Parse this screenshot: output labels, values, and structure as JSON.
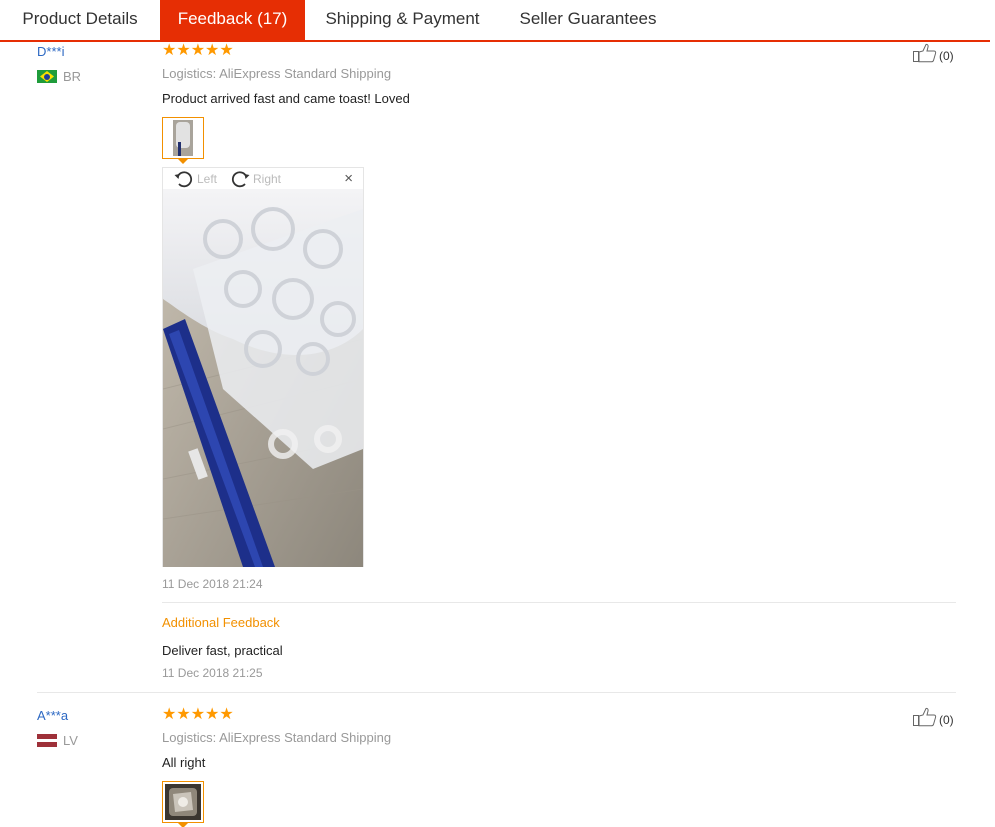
{
  "tabs": [
    {
      "label": "Product Details",
      "active": false
    },
    {
      "label": "Feedback (17)",
      "active": true
    },
    {
      "label": "Shipping & Payment",
      "active": false
    },
    {
      "label": "Seller Guarantees",
      "active": false
    }
  ],
  "reviews": [
    {
      "user": "D***i",
      "country": "BR",
      "stars": "★★★★★",
      "logistics": "Logistics: AliExpress Standard Shipping",
      "comment": "Product arrived fast and came toast! Loved",
      "helpful_count": "(0)",
      "viewer": {
        "left_label": "Left",
        "right_label": "Right",
        "close": "×"
      },
      "date": "11 Dec 2018 21:24",
      "additional_label": "Additional Feedback",
      "additional_comment": "Deliver fast, practical",
      "additional_date": "11 Dec 2018 21:25"
    },
    {
      "user": "A***a",
      "country": "LV",
      "stars": "★★★★★",
      "logistics": "Logistics: AliExpress Standard Shipping",
      "comment": "All right",
      "helpful_count": "(0)"
    }
  ],
  "colors": {
    "accent": "#e62e04",
    "stars": "#ff9900",
    "user_link": "#2c68c3",
    "additional": "#f29000"
  },
  "icons": [
    "thumbs-up-icon",
    "rotate-left-icon",
    "rotate-right-icon",
    "close-icon",
    "flag-br-icon",
    "flag-lv-icon"
  ]
}
